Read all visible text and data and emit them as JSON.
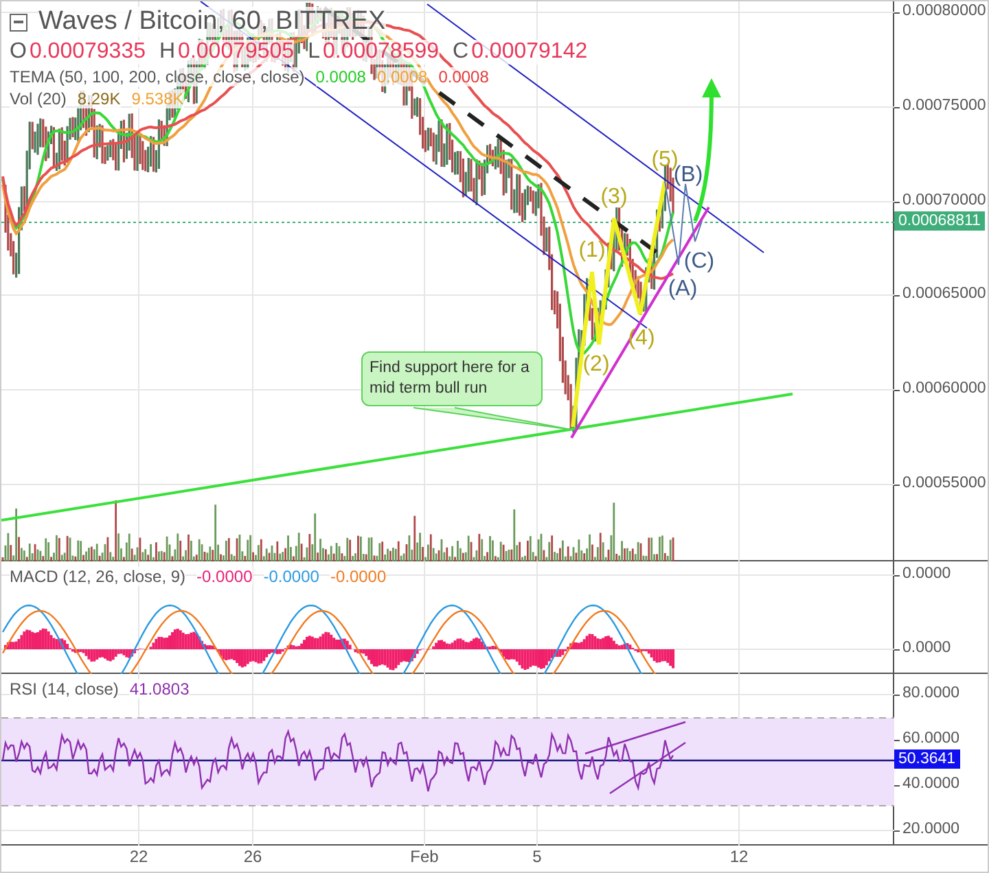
{
  "chart": {
    "title": "Waves / Bitcoin, 60, BITTREX",
    "ohlc": [
      {
        "label": "O",
        "value": "0.00079335"
      },
      {
        "label": "H",
        "value": "0.00079505"
      },
      {
        "label": "L",
        "value": "0.00078599"
      },
      {
        "label": "C",
        "value": "0.00079142"
      }
    ],
    "indicators": [
      {
        "label": "TEMA (50, 100, 200, close, close, close)",
        "values": [
          {
            "text": "0.0008",
            "color": "#22cc22"
          },
          {
            "text": "0.0008",
            "color": "#f0a030"
          },
          {
            "text": "0.0008",
            "color": "#e83a3a"
          }
        ]
      },
      {
        "label": "Vol (20)",
        "values": [
          {
            "text": "8.29K",
            "color": "#8a6a1a"
          },
          {
            "text": "9.538K",
            "color": "#f0a030"
          }
        ]
      }
    ]
  },
  "annotations": {
    "callout": "Find support here for a mid term bull run",
    "waves": [
      "(1)",
      "(2)",
      "(3)",
      "(4)",
      "(5)"
    ],
    "corrections": [
      "(A)",
      "(B)",
      "(C)"
    ]
  },
  "price_axis": {
    "labels": [
      "0.00080000",
      "0.00075000",
      "0.00070000",
      "0.00065000",
      "0.00060000",
      "0.00055000"
    ],
    "last_price": "0.00068811"
  },
  "macd": {
    "label": "MACD (12, 26, close, 9)",
    "values": [
      {
        "text": "-0.0000",
        "color": "#e8207a"
      },
      {
        "text": "-0.0000",
        "color": "#2a9ae0"
      },
      {
        "text": "-0.0000",
        "color": "#f07a20"
      }
    ],
    "axis_labels": [
      "0.0000",
      "0.0000"
    ]
  },
  "rsi": {
    "label": "RSI (14, close)",
    "value": "41.0803",
    "axis_labels": [
      "80.0000",
      "60.0000",
      "40.0000",
      "20.0000"
    ],
    "last_value": "50.3641"
  },
  "time_axis": [
    "22",
    "26",
    "Feb",
    "5",
    "12"
  ]
}
